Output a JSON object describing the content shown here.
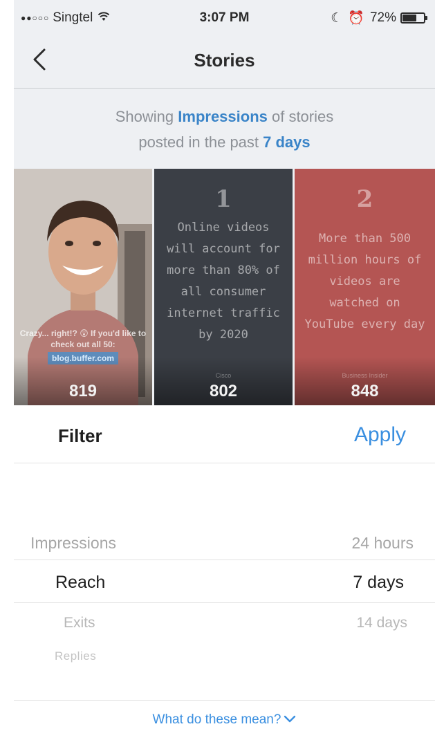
{
  "status_bar": {
    "carrier": "Singtel",
    "time": "3:07 PM",
    "battery": "72%",
    "battery_level": 0.72
  },
  "nav": {
    "title": "Stories",
    "back_icon": "chevron-left-icon"
  },
  "subtitle": {
    "prefix": "Showing ",
    "metric": "Impressions",
    "middle": " of stories",
    "line2_prefix": "posted in the past ",
    "period": "7 days"
  },
  "stories": [
    {
      "caption": "Crazy... right!? 😲 If you'd like to check out all 50:",
      "link": "blog.buffer.com",
      "count": "819"
    },
    {
      "headline": "1",
      "text": "Online videos will account for more than 80% of all consumer internet traffic by 2020",
      "credit": "Cisco",
      "count": "802"
    },
    {
      "headline": "2",
      "text": "More than 500 million hours of videos are watched on YouTube every day",
      "credit": "Business Insider",
      "count": "848"
    }
  ],
  "filter": {
    "title": "Filter",
    "apply_label": "Apply"
  },
  "picker": {
    "metrics": [
      "Impressions",
      "Reach",
      "Exits",
      "Replies"
    ],
    "periods": [
      "24 hours",
      "7 days",
      "14 days"
    ],
    "selected_metric": "Reach",
    "selected_period": "7 days"
  },
  "help": {
    "label": "What do these mean?"
  },
  "colors": {
    "accent": "#3a8fe0",
    "highlight": "#3a84c8",
    "tile_dark": "#3b3f46",
    "tile_red": "#b45553"
  }
}
